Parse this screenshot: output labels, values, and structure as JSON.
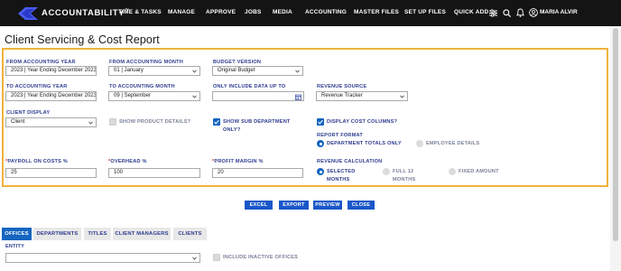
{
  "nav": {
    "logo": "ACCOUNTABILITY",
    "logo_mark": "™",
    "items": [
      "TIME & TASKS",
      "MANAGE",
      "APPROVE",
      "JOBS",
      "MEDIA",
      "ACCOUNTING",
      "MASTER FILES",
      "SET UP FILES",
      "QUICK ADD"
    ],
    "user": "MARIA ALVIR"
  },
  "page": {
    "title": "Client Servicing & Cost Report"
  },
  "form": {
    "from_year": {
      "label": "FROM ACCOUNTING YEAR",
      "value": "2023 | Year Ending December 2023"
    },
    "from_month": {
      "label": "FROM ACCOUNTING MONTH",
      "value": "01 | January"
    },
    "budget_version": {
      "label": "BUDGET VERSION",
      "value": "Original Budget"
    },
    "to_year": {
      "label": "TO ACCOUNTING YEAR",
      "value": "2023 | Year Ending December 2023"
    },
    "to_month": {
      "label": "TO ACCOUNTING MONTH",
      "value": "09 | September"
    },
    "data_up_to": {
      "label": "ONLY INCLUDE DATA UP TO",
      "value": ""
    },
    "revenue_source": {
      "label": "REVENUE SOURCE",
      "value": "Revenue Tracker"
    },
    "client_display": {
      "label": "CLIENT DISPLAY",
      "value": "Client"
    },
    "show_product": {
      "label": "SHOW PRODUCT DETAILS?",
      "checked": false
    },
    "show_sub_dept": {
      "label_line1": "SHOW SUB DEPARTMENT",
      "label_line2": "ONLY?",
      "checked": true
    },
    "display_cost": {
      "label": "DISPLAY COST COLUMNS?",
      "checked": true
    },
    "report_format": {
      "label": "REPORT FORMAT",
      "options": [
        "DEPARTMENT TOTALS ONLY",
        "EMPLOYEE DETAILS"
      ],
      "selected": 0
    },
    "payroll": {
      "required_mark": "*",
      "label": "PAYROLL ON COSTS %",
      "value": "25"
    },
    "overhead": {
      "required_mark": "*",
      "label": "OVERHEAD %",
      "value": "100"
    },
    "profit_margin": {
      "required_mark": "*",
      "label": "PROFIT MARGIN %",
      "value": "20"
    },
    "revenue_calc": {
      "label": "REVENUE CALCULATION",
      "options": [
        {
          "line1": "SELECTED",
          "line2": "MONTHS"
        },
        {
          "line1": "FULL 12",
          "line2": "MONTHS"
        },
        {
          "line1": "FIXED AMOUNT",
          "line2": ""
        }
      ],
      "selected": 0
    }
  },
  "actions": [
    "EXCEL",
    "EXPORT",
    "PREVIEW",
    "CLOSE"
  ],
  "tabs": [
    "OFFICES",
    "DEPARTMENTS",
    "TITLES",
    "CLIENT MANAGERS",
    "CLIENTS"
  ],
  "tab_active": 0,
  "entity": {
    "label": "ENTITY",
    "value": ""
  },
  "include_inactive": {
    "label": "INCLUDE INACTIVE OFFICES",
    "checked": false
  },
  "colors": {
    "topbar": "#141414",
    "accent_blue": "#1565c0",
    "button_blue": "#1a57c9",
    "panel_border": "#f0b23c",
    "label": "#2e3c8f",
    "required": "#e0302f",
    "logo_blue": "#4a5cf0"
  },
  "icons": [
    "logo-mark-icon",
    "sliders-icon",
    "search-icon",
    "bell-icon",
    "user-circle-icon",
    "calendar-icon",
    "chevron-down-icon",
    "checkmark-icon"
  ]
}
